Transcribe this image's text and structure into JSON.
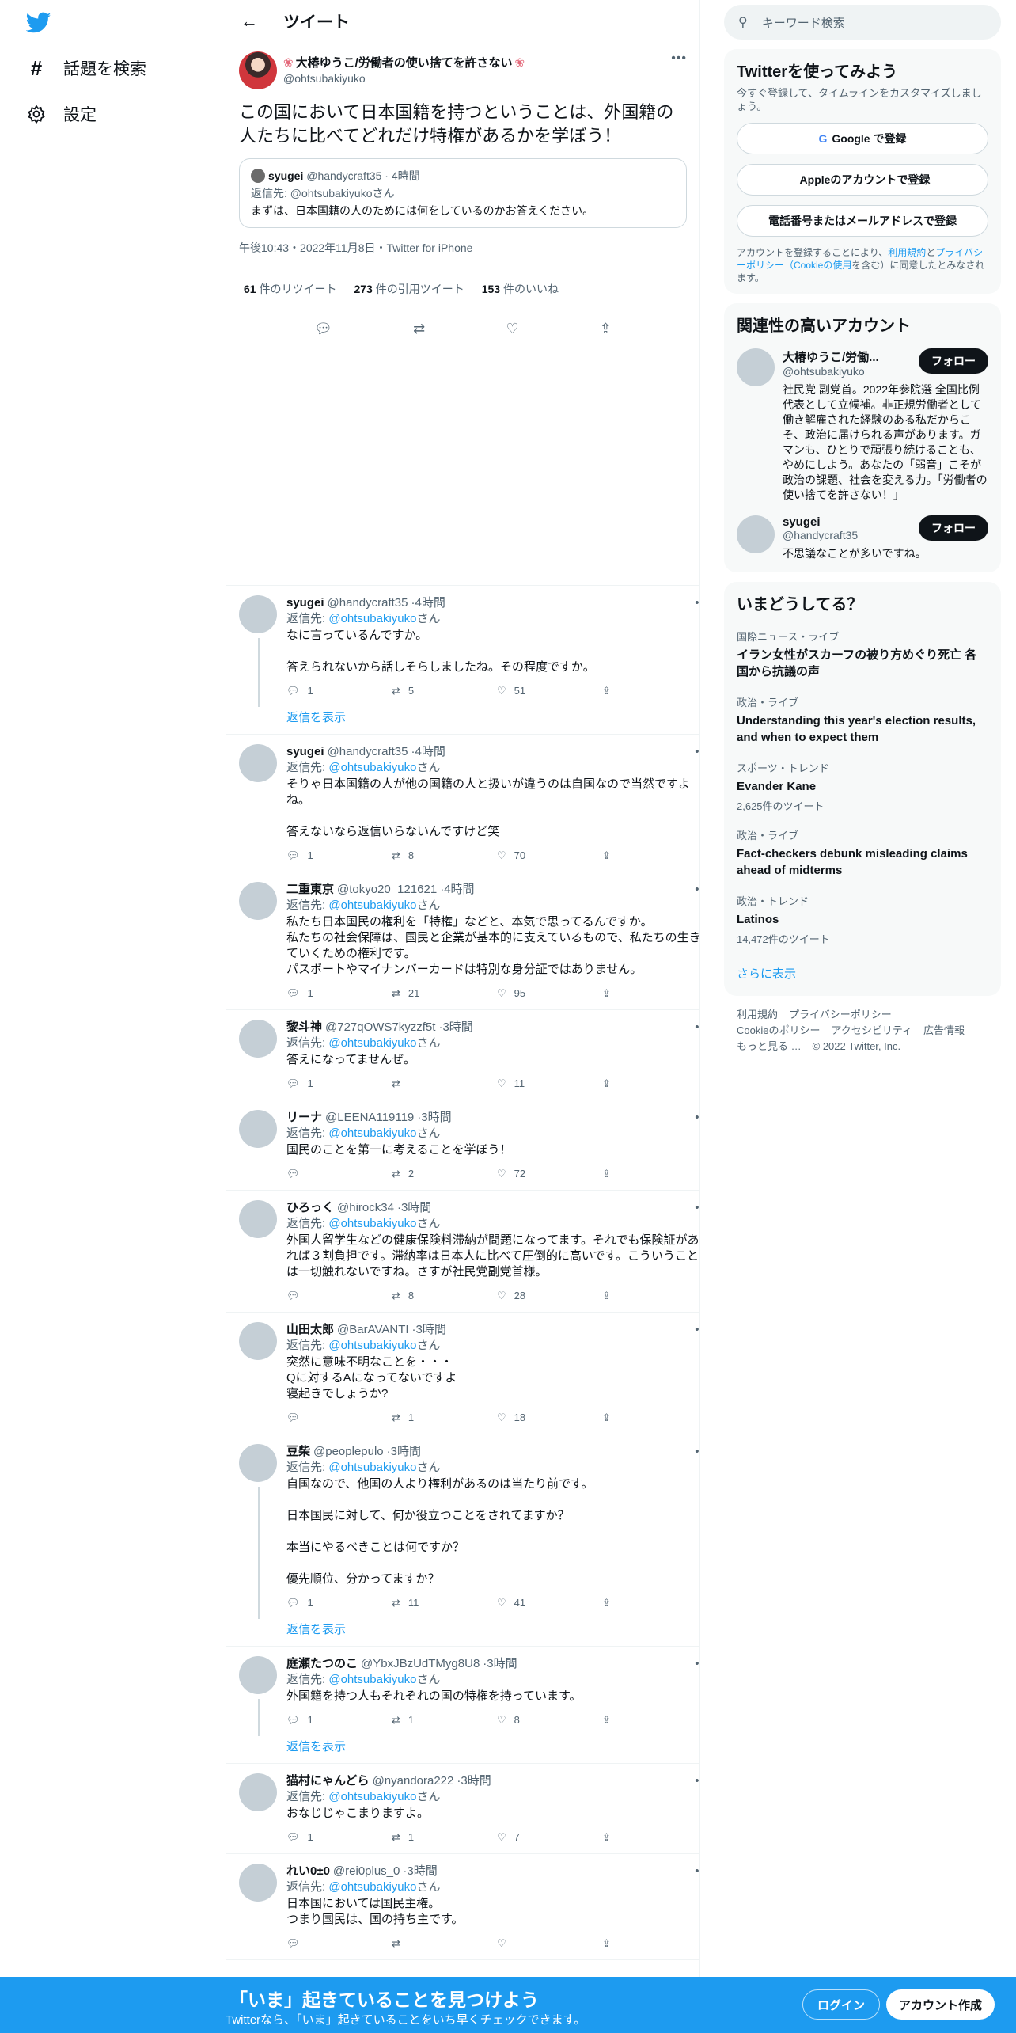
{
  "nav": {
    "items": [
      {
        "icon": "hash-icon",
        "label": "話題を検索"
      },
      {
        "icon": "gear-icon",
        "label": "設定"
      }
    ]
  },
  "header": {
    "title": "ツイート"
  },
  "main_tweet": {
    "author_name": "大椿ゆうこ/労働者の使い捨てを許さない",
    "author_handle": "@ohtsubakiyuko",
    "text": "この国において日本国籍を持つということは、外国籍の人たちに比べてどれだけ特権があるかを学ぼう！",
    "quote": {
      "name": "syugei",
      "handle": "@handycraft35",
      "time": "4時間",
      "reply_to": "返信先: @ohtsubakiyukoさん",
      "text": "まずは、日本国籍の人のためには何をしているのかお答えください。"
    },
    "meta": "午後10:43・2022年11月8日・Twitter for iPhone",
    "retweets": "61",
    "retweets_label": "件のリツイート",
    "quotes": "273",
    "quotes_label": "件の引用ツイート",
    "likes": "153",
    "likes_label": "件のいいね"
  },
  "replies": [
    {
      "name": "syugei",
      "handle": "@handycraft35",
      "time": "4時間",
      "text": "なに言っているんですか。\n\n答えられないから話しそらしましたね。その程度ですか。",
      "reply": "1",
      "rt": "5",
      "like": "51",
      "show_replies": "返信を表示"
    },
    {
      "name": "syugei",
      "handle": "@handycraft35",
      "time": "4時間",
      "text": "そりゃ日本国籍の人が他の国籍の人と扱いが違うのは自国なので当然ですよね。\n\n答えないなら返信いらないんですけど笑",
      "reply": "1",
      "rt": "8",
      "like": "70"
    },
    {
      "name": "二重東京",
      "handle": "@tokyo20_121621",
      "time": "4時間",
      "text": "私たち日本国民の権利を「特権」などと、本気で思ってるんですか。\n私たちの社会保障は、国民と企業が基本的に支えているもので、私たちの生きていくための権利です。\nパスポートやマイナンバーカードは特別な身分証ではありません。",
      "reply": "1",
      "rt": "21",
      "like": "95"
    },
    {
      "name": "黎斗神",
      "handle": "@727qOWS7kyzzf5t",
      "time": "3時間",
      "text": "答えになってませんぜ。",
      "reply": "1",
      "rt": "",
      "like": "11"
    },
    {
      "name": "リーナ",
      "handle": "@LEENA119119",
      "time": "3時間",
      "text": "国民のことを第一に考えることを学ぼう！",
      "reply": "",
      "rt": "2",
      "like": "72"
    },
    {
      "name": "ひろっく",
      "handle": "@hirock34",
      "time": "3時間",
      "text": "外国人留学生などの健康保険料滞納が問題になってます。それでも保険証があれば３割負担です。滞納率は日本人に比べて圧倒的に高いです。こういうことは一切触れないですね。さすが社民党副党首様。",
      "reply": "",
      "rt": "8",
      "like": "28"
    },
    {
      "name": "山田太郎",
      "handle": "@BarAVANTI",
      "time": "3時間",
      "text": "突然に意味不明なことを・・・\nQに対するAになってないですよ\n寝起きでしょうか?",
      "reply": "",
      "rt": "1",
      "like": "18"
    },
    {
      "name": "豆柴",
      "handle": "@peoplepulo",
      "time": "3時間",
      "text": "自国なので、他国の人より権利があるのは当たり前です。\n\n日本国民に対して、何か役立つことをされてますか？\n\n本当にやるべきことは何ですか？\n\n優先順位、分かってますか？",
      "reply": "1",
      "rt": "11",
      "like": "41",
      "show_replies": "返信を表示"
    },
    {
      "name": "庭瀬たつのこ",
      "handle": "@YbxJBzUdTMyg8U8",
      "time": "3時間",
      "text": "外国籍を持つ人もそれぞれの国の特権を持っています。",
      "reply": "1",
      "rt": "1",
      "like": "8",
      "show_replies": "返信を表示"
    },
    {
      "name": "猫村にゃんどら",
      "handle": "@nyandora222",
      "time": "3時間",
      "text": "おなじじゃこまりますよ。",
      "reply": "1",
      "rt": "1",
      "like": "7"
    },
    {
      "name": "れい0±0",
      "handle": "@rei0plus_0",
      "time": "3時間",
      "text": "日本国においては国民主権。\nつまり国民は、国の持ち主です。",
      "reply": "",
      "rt": "",
      "like": ""
    }
  ],
  "reply_to_prefix": "返信先: ",
  "reply_to_handle": "@ohtsubakiyuko",
  "reply_to_suffix": "さん",
  "search": {
    "placeholder": "キーワード検索"
  },
  "signup_card": {
    "title": "Twitterを使ってみよう",
    "subtitle": "今すぐ登録して、タイムラインをカスタマイズしましょう。",
    "google": "Google で登録",
    "apple": "Appleのアカウントで登録",
    "email": "電話番号またはメールアドレスで登録",
    "legal_1": "アカウントを登録することにより、",
    "legal_terms": "利用規約",
    "legal_2": "と",
    "legal_privacy": "プライバシーポリシー（Cookieの使用",
    "legal_3": "を含む）に同意したとみなされます。"
  },
  "related": {
    "title": "関連性の高いアカウント",
    "accounts": [
      {
        "name": "大椿ゆうこ/労働...",
        "handle": "@ohtsubakiyuko",
        "bio": "社民党 副党首。2022年参院選 全国比例代表として立候補。非正規労働者として働き解雇された経験のある私だからこそ、政治に届けられる声があります。ガマンも、ひとりで頑張り続けることも、やめにしよう。あなたの「弱音」こそが政治の課題、社会を変える力。「労働者の使い捨てを許さない！」",
        "follow": "フォロー"
      },
      {
        "name": "syugei",
        "handle": "@handycraft35",
        "bio": "不思議なことが多いですね。",
        "follow": "フォロー"
      }
    ]
  },
  "trends": {
    "title": "いまどうしてる？",
    "items": [
      {
        "context": "国際ニュース・ライブ",
        "name": "イラン女性がスカーフの被り方めぐり死亡 各国から抗議の声",
        "count": ""
      },
      {
        "context": "政治・ライブ",
        "name": "Understanding this year's election results, and when to expect them",
        "count": ""
      },
      {
        "context": "スポーツ・トレンド",
        "name": "Evander Kane",
        "count": "2,625件のツイート"
      },
      {
        "context": "政治・ライブ",
        "name": "Fact-checkers debunk misleading claims ahead of midterms",
        "count": ""
      },
      {
        "context": "政治・トレンド",
        "name": "Latinos",
        "count": "14,472件のツイート"
      }
    ],
    "show_more": "さらに表示"
  },
  "footer": {
    "links": [
      "利用規約",
      "プライバシーポリシー",
      "Cookieのポリシー",
      "アクセシビリティ",
      "広告情報",
      "もっと見る …",
      "© 2022 Twitter, Inc."
    ]
  },
  "bottom_bar": {
    "title": "「いま」起きていることを見つけよう",
    "subtitle": "Twitterなら、「いま」起きていることをいち早くチェックできます。",
    "login": "ログイン",
    "signup": "アカウント作成"
  }
}
